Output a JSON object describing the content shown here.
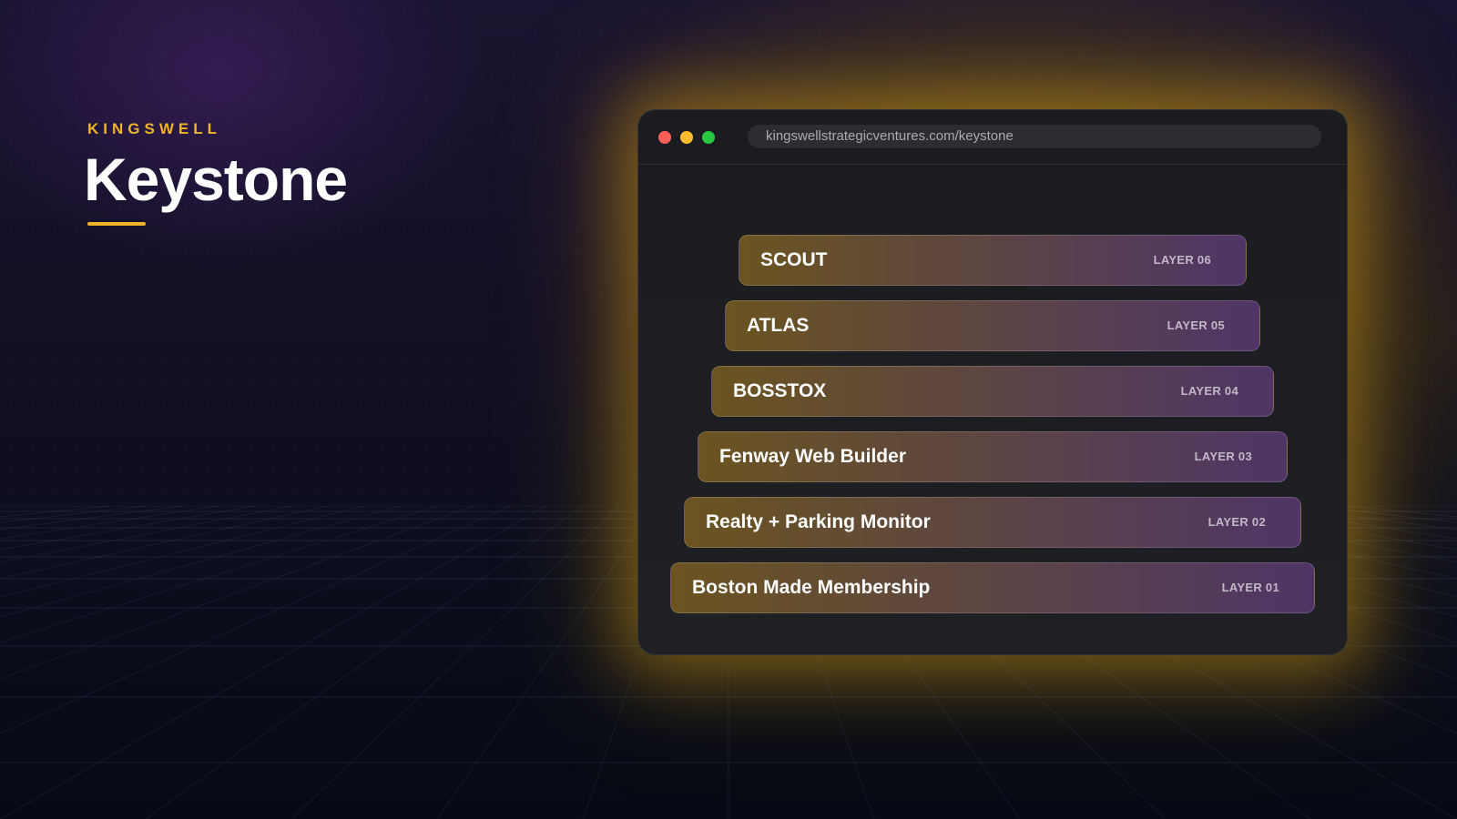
{
  "hero": {
    "brand": "KINGSWELL",
    "title": "Keystone"
  },
  "browser": {
    "url": "kingswellstrategicventures.com/keystone",
    "traffic_lights": [
      "close-dot",
      "minimize-dot",
      "maximize-dot"
    ]
  },
  "layers": [
    {
      "name": "SCOUT",
      "tag": "LAYER 06"
    },
    {
      "name": "ATLAS",
      "tag": "LAYER 05"
    },
    {
      "name": "BOSSTOX",
      "tag": "LAYER 04"
    },
    {
      "name": "Fenway Web Builder",
      "tag": "LAYER 03"
    },
    {
      "name": "Realty + Parking Monitor",
      "tag": "LAYER 02"
    },
    {
      "name": "Boston Made Membership",
      "tag": "LAYER 01"
    }
  ],
  "colors": {
    "accent": "#f0b429",
    "glow": "#e8aa14",
    "layer_start": "#6b5420",
    "layer_end": "#4f3566"
  }
}
